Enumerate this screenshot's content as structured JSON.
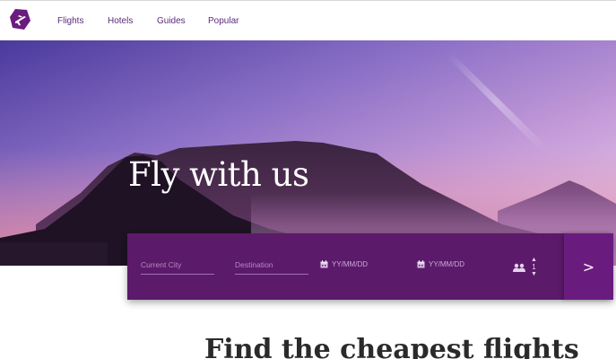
{
  "nav": {
    "logo_icon": "airplane-logo-icon",
    "links": [
      "Flights",
      "Hotels",
      "Guides",
      "Popular"
    ]
  },
  "hero": {
    "title": "Fly with us"
  },
  "search": {
    "current_city_placeholder": "Current City",
    "destination_placeholder": "Destination",
    "depart_date": "YY/MM/DD",
    "return_date": "YY/MM/DD",
    "passengers": "1",
    "submit_label": ">"
  },
  "section": {
    "heading": "Find the cheapest flights"
  },
  "colors": {
    "brand": "#5c1a6b",
    "submit": "#6a1c7e",
    "nav_text": "#5a2a7a"
  }
}
